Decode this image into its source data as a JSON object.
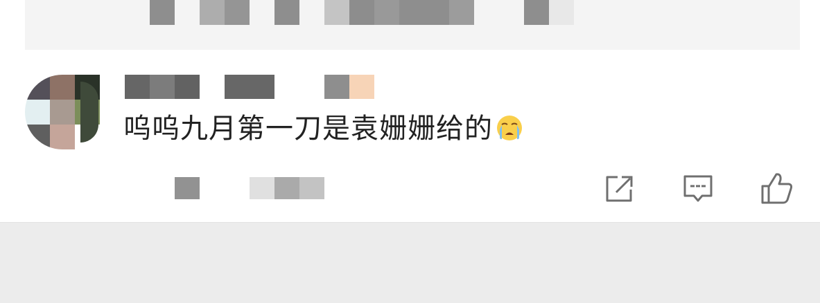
{
  "comment": {
    "text": "呜呜九月第一刀是袁姗姗给的",
    "emoji": "loudly-crying-face"
  },
  "actions": [
    {
      "name": "share-button",
      "icon": "share-icon"
    },
    {
      "name": "reply-button",
      "icon": "comment-icon"
    },
    {
      "name": "like-button",
      "icon": "thumbs-up-icon"
    }
  ],
  "colors": {
    "card_bg": "#ffffff",
    "page_bg": "#ececec",
    "quote_bg": "#f4f4f4",
    "text": "#222222",
    "icon": "#6f6f6f"
  }
}
